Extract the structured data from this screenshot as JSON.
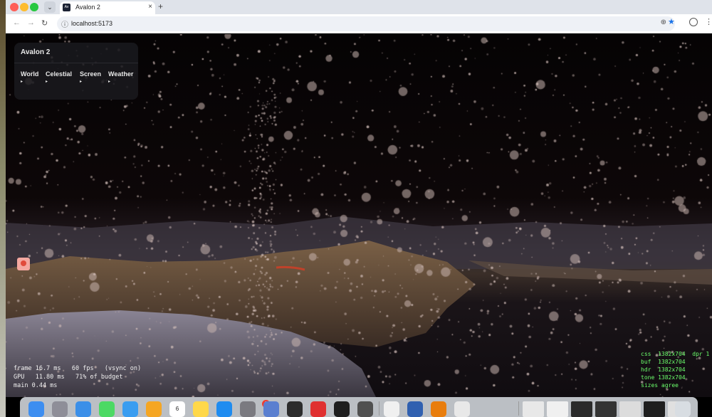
{
  "browser": {
    "tab_title": "Avalon 2",
    "favicon_text": "Av",
    "tab_close": "×",
    "new_tab": "+",
    "tab_menu": "⌄",
    "url": "localhost:5173",
    "nav": {
      "back": "←",
      "forward": "→",
      "reload": "↻"
    },
    "icons": {
      "site": "ⓘ",
      "zoom": "⊕",
      "star": "★",
      "menu": "⋮"
    }
  },
  "panel": {
    "title": "Avalon 2",
    "menus": [
      {
        "label": "World",
        "arrow": "▸"
      },
      {
        "label": "Celestial",
        "arrow": "▸"
      },
      {
        "label": "Screen",
        "arrow": "▸"
      },
      {
        "label": "Weather",
        "arrow": "▸"
      }
    ]
  },
  "perf": {
    "line1": "frame 16.7 ms   60 fps   (vsync on)",
    "line2": "GPU   11.80 ms   71% of budget",
    "line3": "main 0.44 ms"
  },
  "dims": {
    "line1": "css  1382x704  dpr 1",
    "line2": "buf  1382x704",
    "line3": "hdr  1382x704",
    "line4": "tone 1382x704",
    "line5": "sizes agree"
  },
  "dock": {
    "calendar_day": "6",
    "notification_badge": "1",
    "apps": [
      {
        "name": "finder",
        "color": "#3d8ef0"
      },
      {
        "name": "launchpad",
        "color": "#8e8e98"
      },
      {
        "name": "safari",
        "color": "#3b8fe8"
      },
      {
        "name": "messages",
        "color": "#4cd964"
      },
      {
        "name": "mail",
        "color": "#3a9df0"
      },
      {
        "name": "photos",
        "color": "#f5a623"
      },
      {
        "name": "calendar",
        "color": "#ffffff"
      },
      {
        "name": "notes",
        "color": "#ffd84a"
      },
      {
        "name": "app-store",
        "color": "#1f8cf0"
      },
      {
        "name": "system-settings",
        "color": "#7a7a80"
      },
      {
        "name": "preview",
        "color": "#5a7fd0"
      },
      {
        "name": "activity-monitor",
        "color": "#2c2c2c"
      },
      {
        "name": "books",
        "color": "#e03030"
      },
      {
        "name": "terminal",
        "color": "#1e1e1e"
      },
      {
        "name": "screenshot",
        "color": "#505050"
      },
      {
        "name": "text-edit",
        "color": "#f0f0f0"
      },
      {
        "name": "automator",
        "color": "#3060b0"
      },
      {
        "name": "blender",
        "color": "#e87d0d"
      },
      {
        "name": "chrome",
        "color": "#e8e8e8"
      }
    ]
  }
}
